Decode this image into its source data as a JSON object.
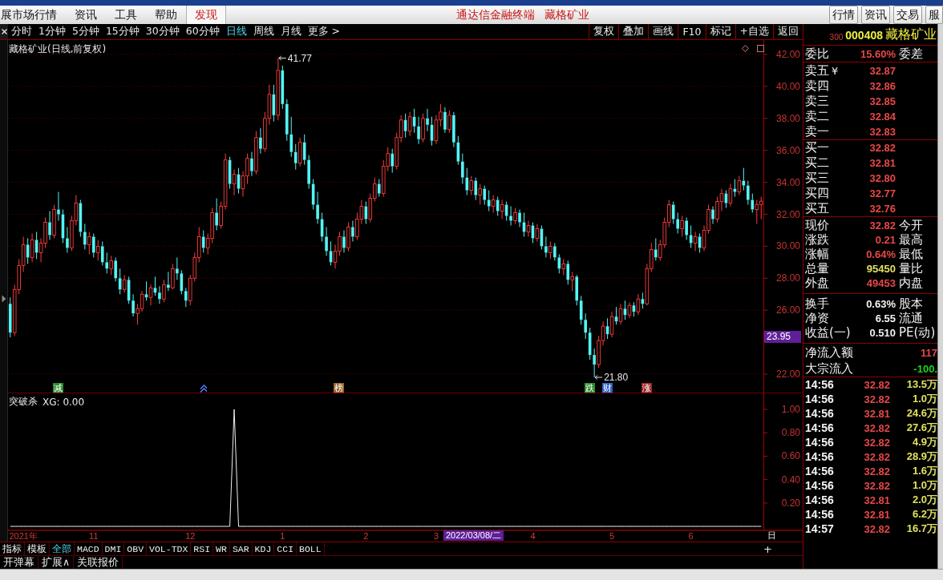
{
  "menu_bar": {
    "items": [
      {
        "label": "展市场行情",
        "selected": false
      },
      {
        "label": "资讯",
        "selected": false
      },
      {
        "label": "工具",
        "selected": false
      },
      {
        "label": "帮助",
        "selected": false
      },
      {
        "label": "发现",
        "selected": true
      }
    ],
    "title": [
      "通达信金融终端",
      "藏格矿业"
    ],
    "buttons": [
      "行情",
      "资讯",
      "交易",
      "服"
    ]
  },
  "toolbar": {
    "periods": [
      {
        "label": "分时",
        "selected": false
      },
      {
        "label": "1分钟",
        "selected": false
      },
      {
        "label": "5分钟",
        "selected": false
      },
      {
        "label": "15分钟",
        "selected": false
      },
      {
        "label": "30分钟",
        "selected": false
      },
      {
        "label": "60分钟",
        "selected": false
      },
      {
        "label": "日线",
        "selected": true
      },
      {
        "label": "周线",
        "selected": false
      },
      {
        "label": "月线",
        "selected": false
      },
      {
        "label": "更多 >",
        "selected": false
      }
    ],
    "actions": [
      "复权",
      "叠加",
      "画线",
      "F10",
      "标记",
      "+自选",
      "返回"
    ]
  },
  "price_pane": {
    "title": "藏格矿业(日线,前复权)",
    "chart_data": {
      "type": "candlestick",
      "ylim": [
        20.85,
        42.9
      ],
      "grid": true,
      "yticks": [
        {
          "value": 42,
          "label": "42.00"
        },
        {
          "value": 40,
          "label": "40.00"
        },
        {
          "value": 38,
          "label": "38.00"
        },
        {
          "value": 36,
          "label": "36.00"
        },
        {
          "value": 34,
          "label": "34.00"
        },
        {
          "value": 32,
          "label": "32.00"
        },
        {
          "value": 30,
          "label": "30.00"
        },
        {
          "value": 28,
          "label": "28.00"
        },
        {
          "value": 26,
          "label": "26.00"
        },
        {
          "value": 22,
          "label": "22.00"
        }
      ],
      "ohlc": [
        [
          26.4,
          26.8,
          24.3,
          24.6
        ],
        [
          24.6,
          27.6,
          24.4,
          27.3
        ],
        [
          27.3,
          29.2,
          27.0,
          28.8
        ],
        [
          28.8,
          30.6,
          28.4,
          30.1
        ],
        [
          30.1,
          30.5,
          28.9,
          29.3
        ],
        [
          29.3,
          30.8,
          29.0,
          30.4
        ],
        [
          30.4,
          30.9,
          29.2,
          29.6
        ],
        [
          29.6,
          30.5,
          29.0,
          30.2
        ],
        [
          30.2,
          31.8,
          29.9,
          31.5
        ],
        [
          31.5,
          32.2,
          30.4,
          30.7
        ],
        [
          30.7,
          32.6,
          30.5,
          32.3
        ],
        [
          32.3,
          33.4,
          31.6,
          32.0
        ],
        [
          32.0,
          32.3,
          30.2,
          30.5
        ],
        [
          30.5,
          31.2,
          29.6,
          29.9
        ],
        [
          29.9,
          31.9,
          29.7,
          31.6
        ],
        [
          31.6,
          33.2,
          31.3,
          32.7
        ],
        [
          32.7,
          32.9,
          30.6,
          30.9
        ],
        [
          30.9,
          31.4,
          29.8,
          30.1
        ],
        [
          30.1,
          30.9,
          29.5,
          30.6
        ],
        [
          30.6,
          30.8,
          29.3,
          29.6
        ],
        [
          29.6,
          30.4,
          29.1,
          30.0
        ],
        [
          30.0,
          30.3,
          28.8,
          29.0
        ],
        [
          29.0,
          29.6,
          28.3,
          28.6
        ],
        [
          28.6,
          29.4,
          28.2,
          29.1
        ],
        [
          29.1,
          29.3,
          27.8,
          28.0
        ],
        [
          28.0,
          28.6,
          27.0,
          27.3
        ],
        [
          27.3,
          28.2,
          27.1,
          27.9
        ],
        [
          27.9,
          28.1,
          26.4,
          26.6
        ],
        [
          26.6,
          27.0,
          25.6,
          25.8
        ],
        [
          25.8,
          26.4,
          25.1,
          26.1
        ],
        [
          26.1,
          27.2,
          25.9,
          27.0
        ],
        [
          27.0,
          27.8,
          26.6,
          26.8
        ],
        [
          26.8,
          27.6,
          26.3,
          27.4
        ],
        [
          27.4,
          28.1,
          26.9,
          27.1
        ],
        [
          27.1,
          27.5,
          26.4,
          26.7
        ],
        [
          26.7,
          27.9,
          26.5,
          27.6
        ],
        [
          27.6,
          28.4,
          27.2,
          27.4
        ],
        [
          27.4,
          28.9,
          27.3,
          28.6
        ],
        [
          28.6,
          29.3,
          27.9,
          28.3
        ],
        [
          28.3,
          28.5,
          27.0,
          27.2
        ],
        [
          27.2,
          27.4,
          26.2,
          26.6
        ],
        [
          26.6,
          28.2,
          26.3,
          28.0
        ],
        [
          28.0,
          29.6,
          27.8,
          29.3
        ],
        [
          29.3,
          31.2,
          29.0,
          30.6
        ],
        [
          30.6,
          31.0,
          29.6,
          29.9
        ],
        [
          29.9,
          30.8,
          29.5,
          30.5
        ],
        [
          30.5,
          32.4,
          30.2,
          32.1
        ],
        [
          32.1,
          33.0,
          31.0,
          31.3
        ],
        [
          31.3,
          32.8,
          31.1,
          32.5
        ],
        [
          32.5,
          35.8,
          32.3,
          35.4
        ],
        [
          35.4,
          35.6,
          33.6,
          33.9
        ],
        [
          33.9,
          34.8,
          33.2,
          34.5
        ],
        [
          34.5,
          34.9,
          33.3,
          33.6
        ],
        [
          33.6,
          34.7,
          33.1,
          34.4
        ],
        [
          34.4,
          35.8,
          33.9,
          35.5
        ],
        [
          35.5,
          35.9,
          34.4,
          34.7
        ],
        [
          34.7,
          37.2,
          34.5,
          36.8
        ],
        [
          36.8,
          37.4,
          35.8,
          36.1
        ],
        [
          36.1,
          38.4,
          35.9,
          38.0
        ],
        [
          38.0,
          40.1,
          37.6,
          39.5
        ],
        [
          39.5,
          40.1,
          37.8,
          38.2
        ],
        [
          38.2,
          41.77,
          37.9,
          41.0
        ],
        [
          41.0,
          41.3,
          38.6,
          38.9
        ],
        [
          38.9,
          39.2,
          36.6,
          37.0
        ],
        [
          37.0,
          38.1,
          35.6,
          35.9
        ],
        [
          35.9,
          36.4,
          34.8,
          35.2
        ],
        [
          35.2,
          36.8,
          35.0,
          36.5
        ],
        [
          36.5,
          37.0,
          35.1,
          35.4
        ],
        [
          35.4,
          35.7,
          33.6,
          33.9
        ],
        [
          33.9,
          34.2,
          32.3,
          32.6
        ],
        [
          32.6,
          33.4,
          31.4,
          31.7
        ],
        [
          31.7,
          32.1,
          30.3,
          30.6
        ],
        [
          30.6,
          31.2,
          29.4,
          29.7
        ],
        [
          29.7,
          30.3,
          28.8,
          29.0
        ],
        [
          29.0,
          30.1,
          28.6,
          29.7
        ],
        [
          29.7,
          30.9,
          29.4,
          30.6
        ],
        [
          30.6,
          31.0,
          29.6,
          29.9
        ],
        [
          29.9,
          31.5,
          29.7,
          31.2
        ],
        [
          31.2,
          31.6,
          30.3,
          30.6
        ],
        [
          30.6,
          32.1,
          30.4,
          31.7
        ],
        [
          31.7,
          32.9,
          31.4,
          32.5
        ],
        [
          32.5,
          32.8,
          31.4,
          31.7
        ],
        [
          31.7,
          33.3,
          31.5,
          33.0
        ],
        [
          33.0,
          34.3,
          32.8,
          33.9
        ],
        [
          33.9,
          34.2,
          33.1,
          33.3
        ],
        [
          33.3,
          35.4,
          33.1,
          35.0
        ],
        [
          35.0,
          36.2,
          34.7,
          35.8
        ],
        [
          35.8,
          36.1,
          34.6,
          35.0
        ],
        [
          35.0,
          37.1,
          34.8,
          36.8
        ],
        [
          36.8,
          38.2,
          36.5,
          37.9
        ],
        [
          37.9,
          38.3,
          36.8,
          37.2
        ],
        [
          37.2,
          38.4,
          36.9,
          38.1
        ],
        [
          38.1,
          38.6,
          37.1,
          37.5
        ],
        [
          37.5,
          38.1,
          36.4,
          36.7
        ],
        [
          36.7,
          38.3,
          36.5,
          38.0
        ],
        [
          38.0,
          38.6,
          37.2,
          37.6
        ],
        [
          37.6,
          38.1,
          36.3,
          36.6
        ],
        [
          36.6,
          38.2,
          36.4,
          37.9
        ],
        [
          37.9,
          38.9,
          37.5,
          38.4
        ],
        [
          38.4,
          38.7,
          37.1,
          37.3
        ],
        [
          37.3,
          38.5,
          37.1,
          38.2
        ],
        [
          38.2,
          38.4,
          36.2,
          36.5
        ],
        [
          36.5,
          36.9,
          35.1,
          35.3
        ],
        [
          35.3,
          35.8,
          33.9,
          34.3
        ],
        [
          34.3,
          34.9,
          33.2,
          33.5
        ],
        [
          33.5,
          34.4,
          33.2,
          34.1
        ],
        [
          34.1,
          34.3,
          32.9,
          33.2
        ],
        [
          33.2,
          33.9,
          32.6,
          33.6
        ],
        [
          33.6,
          33.8,
          32.6,
          32.9
        ],
        [
          32.9,
          33.5,
          32.2,
          32.5
        ],
        [
          32.5,
          33.2,
          32.1,
          32.9
        ],
        [
          32.9,
          33.1,
          31.9,
          32.2
        ],
        [
          32.2,
          32.9,
          31.7,
          32.6
        ],
        [
          32.6,
          32.8,
          31.6,
          31.9
        ],
        [
          31.9,
          32.5,
          31.3,
          31.6
        ],
        [
          31.6,
          32.4,
          31.4,
          32.1
        ],
        [
          32.1,
          32.3,
          31.2,
          31.5
        ],
        [
          31.5,
          32.1,
          30.6,
          30.9
        ],
        [
          30.9,
          31.6,
          30.6,
          31.3
        ],
        [
          31.3,
          31.5,
          30.2,
          30.5
        ],
        [
          30.5,
          31.4,
          30.3,
          31.1
        ],
        [
          31.1,
          31.3,
          29.8,
          30.0
        ],
        [
          30.0,
          30.6,
          29.3,
          29.6
        ],
        [
          29.6,
          30.3,
          29.2,
          30.0
        ],
        [
          30.0,
          30.2,
          29.1,
          29.3
        ],
        [
          29.3,
          29.5,
          28.3,
          28.6
        ],
        [
          28.6,
          29.2,
          28.2,
          28.9
        ],
        [
          28.9,
          29.1,
          27.6,
          27.9
        ],
        [
          27.9,
          28.4,
          27.2,
          28.1
        ],
        [
          28.1,
          28.2,
          26.3,
          26.6
        ],
        [
          26.6,
          26.9,
          25.1,
          25.4
        ],
        [
          25.4,
          25.8,
          24.2,
          24.6
        ],
        [
          24.6,
          24.9,
          22.9,
          23.2
        ],
        [
          23.2,
          23.6,
          21.8,
          22.6
        ],
        [
          22.6,
          24.4,
          22.4,
          24.1
        ],
        [
          24.1,
          25.3,
          23.8,
          25.0
        ],
        [
          25.0,
          25.5,
          24.2,
          24.5
        ],
        [
          24.5,
          25.9,
          24.3,
          25.6
        ],
        [
          25.6,
          26.2,
          25.1,
          25.3
        ],
        [
          25.3,
          26.4,
          25.1,
          26.1
        ],
        [
          26.1,
          26.6,
          25.4,
          25.7
        ],
        [
          25.7,
          26.5,
          25.5,
          26.3
        ],
        [
          26.3,
          26.5,
          25.6,
          25.9
        ],
        [
          25.9,
          27.0,
          25.7,
          26.7
        ],
        [
          26.7,
          27.1,
          26.1,
          26.4
        ],
        [
          26.4,
          28.9,
          26.3,
          28.6
        ],
        [
          28.6,
          30.2,
          28.4,
          29.8
        ],
        [
          29.8,
          30.5,
          29.1,
          29.3
        ],
        [
          29.3,
          30.4,
          29.1,
          30.1
        ],
        [
          30.1,
          31.8,
          29.9,
          31.5
        ],
        [
          31.5,
          32.9,
          31.2,
          32.6
        ],
        [
          32.6,
          32.8,
          31.4,
          31.7
        ],
        [
          31.7,
          32.1,
          30.8,
          31.1
        ],
        [
          31.1,
          31.9,
          30.6,
          31.6
        ],
        [
          31.6,
          31.8,
          30.4,
          30.7
        ],
        [
          30.7,
          31.3,
          29.9,
          30.2
        ],
        [
          30.2,
          30.9,
          29.7,
          30.6
        ],
        [
          30.6,
          30.8,
          29.6,
          29.9
        ],
        [
          29.9,
          31.3,
          29.7,
          31.0
        ],
        [
          31.0,
          32.6,
          30.8,
          32.3
        ],
        [
          32.3,
          32.5,
          31.4,
          31.7
        ],
        [
          31.7,
          33.1,
          31.5,
          32.8
        ],
        [
          32.8,
          33.6,
          32.2,
          33.3
        ],
        [
          33.3,
          33.5,
          32.4,
          32.7
        ],
        [
          32.7,
          33.9,
          32.5,
          33.6
        ],
        [
          33.6,
          34.2,
          33.1,
          33.4
        ],
        [
          33.4,
          34.4,
          33.2,
          34.1
        ],
        [
          34.1,
          34.9,
          33.5,
          33.8
        ],
        [
          33.8,
          34.1,
          32.6,
          32.9
        ],
        [
          32.9,
          33.3,
          32.1,
          32.3
        ],
        [
          32.3,
          32.9,
          31.4,
          32.61
        ],
        [
          32.61,
          33.1,
          31.7,
          32.82
        ]
      ],
      "annotations": [
        "41.77",
        "21.80"
      ]
    },
    "signals": [
      {
        "kind": "text",
        "label": "减",
        "color": "#2c8c2c"
      },
      {
        "kind": "icon",
        "color": "#4a7cff"
      },
      {
        "kind": "text",
        "label": "榜",
        "color": "#9a6428"
      },
      {
        "kind": "text",
        "label": "跌",
        "color": "#2c8c2c"
      },
      {
        "kind": "text",
        "label": "财",
        "color": "#2f62c8"
      },
      {
        "kind": "text",
        "label": "涨",
        "color": "#a02828"
      }
    ],
    "cursor": {
      "price_label": "23.95",
      "date_label": "2022/03/08/二"
    }
  },
  "indicator_pane": {
    "title": "突破杀",
    "reading": "XG: 0.00",
    "chart_data": {
      "type": "line",
      "color": "#f0f0f0",
      "ylim": [
        -0.034,
        1.144
      ],
      "yticks": [
        {
          "value": 1,
          "label": "1.00"
        },
        {
          "value": 0.8,
          "label": "0.80"
        },
        {
          "value": 0.6,
          "label": "0.60"
        },
        {
          "value": 0.4,
          "label": "0.40"
        },
        {
          "value": 0.2,
          "label": "0.20"
        }
      ],
      "categories": [
        null,
        null,
        null,
        "2021年",
        null,
        null,
        null,
        null,
        null,
        null,
        null,
        null,
        null,
        null,
        null,
        null,
        null,
        null,
        null,
        "11",
        null,
        null,
        null,
        null,
        null,
        null,
        null,
        null,
        null,
        null,
        null,
        null,
        null,
        null,
        null,
        null,
        null,
        null,
        null,
        null,
        null,
        "12",
        null,
        null,
        null,
        null,
        null,
        null,
        null,
        null,
        null,
        null,
        null,
        null,
        null,
        null,
        null,
        null,
        null,
        null,
        null,
        null,
        "1",
        null,
        null,
        null,
        null,
        null,
        null,
        null,
        null,
        null,
        null,
        null,
        null,
        null,
        null,
        null,
        null,
        null,
        null,
        "2",
        null,
        null,
        null,
        null,
        null,
        null,
        null,
        null,
        null,
        null,
        null,
        null,
        null,
        null,
        null,
        "3",
        null,
        null,
        null,
        null,
        null,
        null,
        null,
        null,
        null,
        null,
        null,
        null,
        null,
        null,
        null,
        null,
        null,
        null,
        null,
        null,
        null,
        "4",
        null,
        null,
        null,
        null,
        null,
        null,
        null,
        null,
        null,
        null,
        null,
        null,
        null,
        null,
        null,
        null,
        null,
        "5",
        null,
        null,
        null,
        null,
        null,
        null,
        null,
        null,
        null,
        null,
        null,
        null,
        null,
        null,
        null,
        null,
        null,
        "6",
        null,
        null,
        null,
        null,
        null,
        null,
        null,
        null,
        null,
        null,
        null,
        null,
        null,
        null,
        null,
        null
      ],
      "values": [
        0,
        0,
        0,
        0,
        0,
        0,
        0,
        0,
        0,
        0,
        0,
        0,
        0,
        0,
        0,
        0,
        0,
        0,
        0,
        0,
        0,
        0,
        0,
        0,
        0,
        0,
        0,
        0,
        0,
        0,
        0,
        0,
        0,
        0,
        0,
        0,
        0,
        0,
        0,
        0,
        0,
        0,
        0,
        0,
        0,
        0,
        0,
        0,
        0,
        0,
        0,
        1,
        0,
        0,
        0,
        0,
        0,
        0,
        0,
        0,
        0,
        0,
        0,
        0,
        0,
        0,
        0,
        0,
        0,
        0,
        0,
        0,
        0,
        0,
        0,
        0,
        0,
        0,
        0,
        0,
        0,
        0,
        0,
        0,
        0,
        0,
        0,
        0,
        0,
        0,
        0,
        0,
        0,
        0,
        0,
        0,
        0,
        0,
        0,
        0,
        0,
        0,
        0,
        0,
        0,
        0,
        0,
        0,
        0,
        0,
        0,
        0,
        0,
        0,
        0,
        0,
        0,
        0,
        0,
        0,
        0,
        0,
        0,
        0,
        0,
        0,
        0,
        0,
        0,
        0,
        0,
        0,
        0,
        0,
        0,
        0,
        0,
        0,
        0,
        0,
        0,
        0,
        0,
        0,
        0,
        0,
        0,
        0,
        0,
        0,
        0,
        0,
        0,
        0,
        0,
        0,
        0,
        0,
        0,
        0,
        0,
        0,
        0,
        0,
        0,
        0,
        0,
        0,
        0,
        0,
        0,
        0
      ]
    }
  },
  "date_axis": {
    "mode_label": "日"
  },
  "indicator_tabs": {
    "tabs": [
      {
        "label": "指标",
        "selected": false
      },
      {
        "label": "模板",
        "selected": false
      },
      {
        "label": "全部",
        "selected": true
      },
      {
        "label": "MACD",
        "selected": false
      },
      {
        "label": "DMI",
        "selected": false
      },
      {
        "label": "OBV",
        "selected": false
      },
      {
        "label": "VOL-TDX",
        "selected": false
      },
      {
        "label": "RSI",
        "selected": false
      },
      {
        "label": "WR",
        "selected": false
      },
      {
        "label": "SAR",
        "selected": false
      },
      {
        "label": "KDJ",
        "selected": false
      },
      {
        "label": "CCI",
        "selected": false
      },
      {
        "label": "BOLL",
        "selected": false
      }
    ],
    "add_label": "+"
  },
  "bottom_buttons": [
    "开弹幕",
    "扩展∧",
    "关联报价"
  ],
  "quote_panel": {
    "tag": "300",
    "code": "000408",
    "name": "藏格矿业",
    "ratio": {
      "label": "委比",
      "value": "15.60%",
      "label2": "委差"
    },
    "asks": [
      {
        "label": "卖五",
        "symbol": "¥",
        "price": "32.87"
      },
      {
        "label": "卖四",
        "price": "32.86"
      },
      {
        "label": "卖三",
        "price": "32.85"
      },
      {
        "label": "卖二",
        "price": "32.84"
      },
      {
        "label": "卖一",
        "price": "32.83"
      }
    ],
    "bids": [
      {
        "label": "买一",
        "price": "32.82"
      },
      {
        "label": "买二",
        "price": "32.81"
      },
      {
        "label": "买三",
        "price": "32.80"
      },
      {
        "label": "买四",
        "price": "32.77"
      },
      {
        "label": "买五",
        "price": "32.76"
      }
    ],
    "stats": [
      {
        "label": "现价",
        "value": "32.82",
        "color": "#e84848",
        "label2": "今开"
      },
      {
        "label": "涨跌",
        "value": "0.21",
        "color": "#e84848",
        "label2": "最高"
      },
      {
        "label": "涨幅",
        "value": "0.64%",
        "color": "#e84848",
        "label2": "最低"
      },
      {
        "label": "总量",
        "value": "95450",
        "color": "#e0e060",
        "label2": "量比"
      },
      {
        "label": "外盘",
        "value": "49453",
        "color": "#e84848",
        "label2": "内盘"
      }
    ],
    "fundamentals": [
      {
        "label": "换手",
        "value": "0.63%",
        "label2": "股本"
      },
      {
        "label": "净资",
        "value": "6.55",
        "label2": "流通"
      },
      {
        "label": "收益(一)",
        "value": "0.510",
        "label2": "PE(动)"
      }
    ],
    "flows": [
      {
        "label": "净流入额",
        "value": "117",
        "color": "#e84848"
      },
      {
        "label": "大宗流入",
        "value": "-100.",
        "color": "#20d020"
      }
    ],
    "trades": [
      {
        "time": "14:56",
        "price": "32.82",
        "volume": "13.5万"
      },
      {
        "time": "14:56",
        "price": "32.82",
        "volume": "1.0万"
      },
      {
        "time": "14:56",
        "price": "32.81",
        "volume": "24.6万"
      },
      {
        "time": "14:56",
        "price": "32.82",
        "volume": "27.6万"
      },
      {
        "time": "14:56",
        "price": "32.82",
        "volume": "4.9万"
      },
      {
        "time": "14:56",
        "price": "32.82",
        "volume": "28.9万"
      },
      {
        "time": "14:56",
        "price": "32.82",
        "volume": "1.6万"
      },
      {
        "time": "14:56",
        "price": "32.82",
        "volume": "1.0万"
      },
      {
        "time": "14:56",
        "price": "32.81",
        "volume": "2.0万"
      },
      {
        "time": "14:56",
        "price": "32.81",
        "volume": "6.2万"
      },
      {
        "time": "14:57",
        "price": "32.82",
        "volume": "16.7万"
      }
    ]
  }
}
